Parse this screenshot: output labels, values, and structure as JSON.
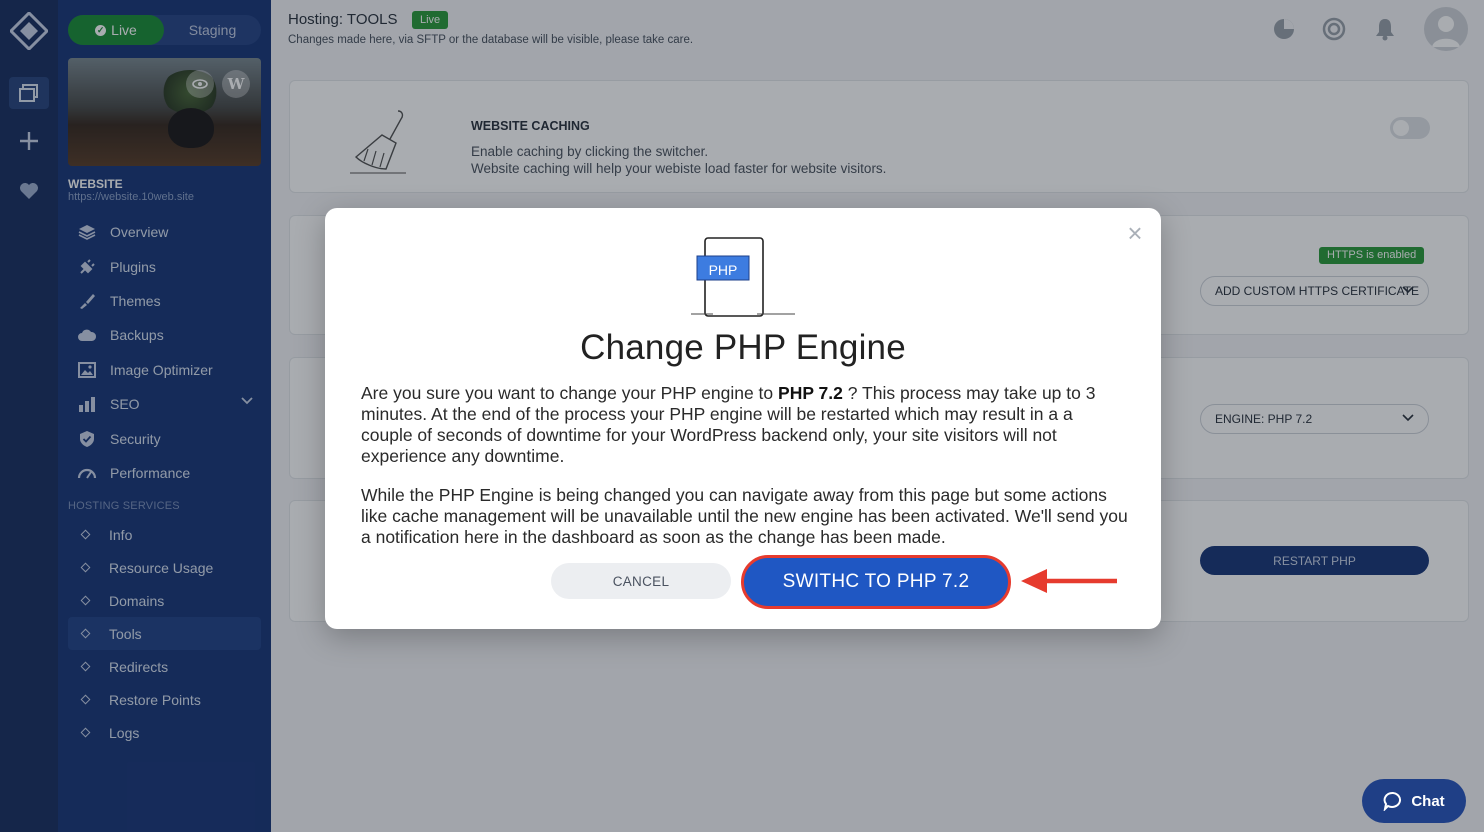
{
  "env": {
    "live_label": "Live",
    "staging_label": "Staging"
  },
  "site": {
    "name": "WEBSITE",
    "url": "https://website.10web.site"
  },
  "nav": {
    "items": [
      {
        "label": "Overview",
        "icon": "layers-icon"
      },
      {
        "label": "Plugins",
        "icon": "plug-icon"
      },
      {
        "label": "Themes",
        "icon": "brush-icon"
      },
      {
        "label": "Backups",
        "icon": "cloud-icon"
      },
      {
        "label": "Image Optimizer",
        "icon": "image-icon"
      },
      {
        "label": "SEO",
        "icon": "bar-chart-icon"
      },
      {
        "label": "Security",
        "icon": "shield-icon"
      },
      {
        "label": "Performance",
        "icon": "gauge-icon"
      }
    ],
    "section_title": "HOSTING SERVICES",
    "sub_items": [
      "Info",
      "Resource Usage",
      "Domains",
      "Tools",
      "Redirects",
      "Restore Points",
      "Logs"
    ],
    "active_sub": "Tools"
  },
  "header": {
    "title": "Hosting: TOOLS",
    "badge": "Live",
    "subtitle": "Changes made here, via SFTP or the database will be visible, please take care."
  },
  "cards": {
    "caching": {
      "title": "WEBSITE CACHING",
      "line1": "Enable caching by clicking the switcher.",
      "line2": "Website caching will help your webiste load faster for website visitors."
    },
    "https": {
      "badge": "HTTPS is enabled",
      "dropdown": "ADD CUSTOM HTTPS CERTIFICATE"
    },
    "engine": {
      "dropdown": "ENGINE: PHP 7.2"
    },
    "restart": {
      "button": "RESTART PHP"
    }
  },
  "modal": {
    "illustration_label": "PHP",
    "title": "Change PHP Engine",
    "p1_before": "Are you sure you want to change your PHP engine to ",
    "p1_bold": "PHP 7.2",
    "p1_after": " ? This process may take up to 3 minutes. At the end of the process your PHP engine will be restarted which may result in a a couple of seconds of downtime for your WordPress backend only, your site visitors will not experience any downtime.",
    "p2": "While the PHP Engine is being changed you can navigate away from this page but some actions like cache management will be unavailable until the new engine has been activated. We'll send you a notification here in the dashboard as soon as the change has been made.",
    "cancel": "CANCEL",
    "confirm": "SWITHC TO PHP 7.2",
    "close_glyph": "×"
  },
  "chat": {
    "label": "Chat"
  },
  "colors": {
    "sidebar": "#1c3a7a",
    "rail": "#1c3263",
    "live_green": "#2d9c3c",
    "primary": "#1f57c3",
    "highlight_red": "#e63b2e"
  }
}
